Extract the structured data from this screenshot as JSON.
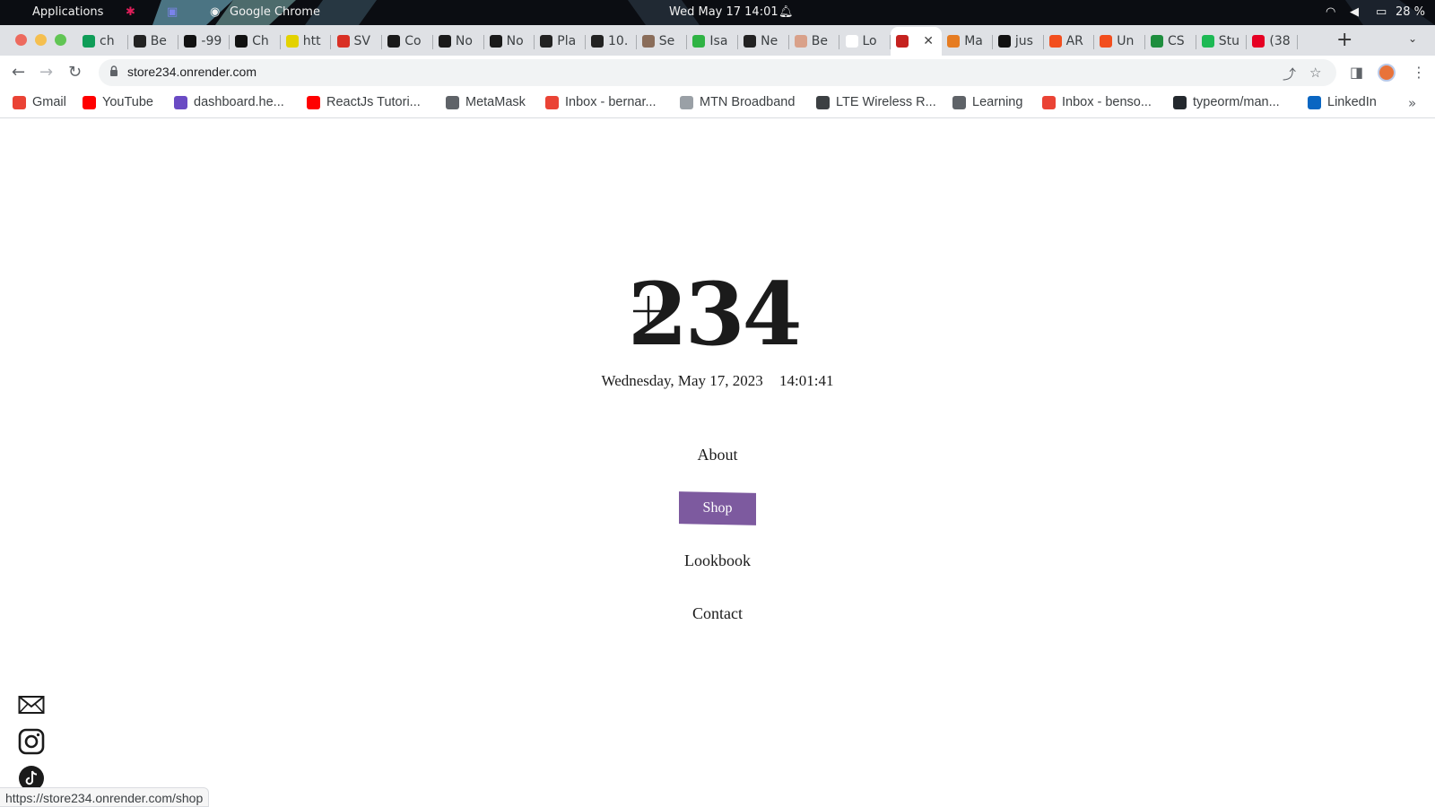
{
  "os_bar": {
    "applications": "Applications",
    "active_app": "Google Chrome",
    "clock": "Wed May 17  14:01",
    "battery": "28 %"
  },
  "tabs": [
    {
      "label": "ch",
      "color": "#0f9d58"
    },
    {
      "label": "Be",
      "color": "#222222",
      "glyph": "W."
    },
    {
      "label": "-99",
      "color": "#111111"
    },
    {
      "label": "Ch",
      "color": "#111111"
    },
    {
      "label": "htt",
      "color": "#e3d200"
    },
    {
      "label": "SV",
      "color": "#d93025"
    },
    {
      "label": "Co",
      "color": "#1a1a1a"
    },
    {
      "label": "No",
      "color": "#1a1a1a"
    },
    {
      "label": "No",
      "color": "#1a1a1a"
    },
    {
      "label": "Pla",
      "color": "#222222"
    },
    {
      "label": "10.",
      "color": "#222222"
    },
    {
      "label": "Se",
      "color": "#8a6d5a"
    },
    {
      "label": "Isa",
      "color": "#2fb344"
    },
    {
      "label": "Ne",
      "color": "#222222"
    },
    {
      "label": "Be",
      "color": "#d9a18a"
    },
    {
      "label": "Lo",
      "color": "#ffffff"
    },
    {
      "label": "",
      "color": "#c5221f",
      "active": true
    },
    {
      "label": "Ma",
      "color": "#e67c22"
    },
    {
      "label": "jus",
      "color": "#111111"
    },
    {
      "label": "AR",
      "color": "#f24e1e"
    },
    {
      "label": "Un",
      "color": "#f24e1e"
    },
    {
      "label": "CS",
      "color": "#1e8e3e"
    },
    {
      "label": "Stu",
      "color": "#1db954"
    },
    {
      "label": "(38",
      "color": "#e60023"
    }
  ],
  "toolbar": {
    "url": "store234.onrender.com"
  },
  "bookmarks": [
    {
      "label": "Gmail",
      "color": "#ea4335"
    },
    {
      "label": "YouTube",
      "color": "#ff0000"
    },
    {
      "label": "dashboard.he...",
      "color": "#6a4bc4"
    },
    {
      "label": "ReactJs Tutori...",
      "color": "#ff0000"
    },
    {
      "label": "MetaMask",
      "color": "#5f6368"
    },
    {
      "label": "Inbox - bernar...",
      "color": "#ea4335"
    },
    {
      "label": "MTN Broadband",
      "color": "#9aa0a6"
    },
    {
      "label": "LTE Wireless R...",
      "color": "#3c4043"
    },
    {
      "label": "Learning",
      "color": "#5f6368"
    },
    {
      "label": "Inbox - benso...",
      "color": "#ea4335"
    },
    {
      "label": "typeorm/man...",
      "color": "#24292e"
    },
    {
      "label": "LinkedIn",
      "color": "#0a66c2"
    }
  ],
  "page": {
    "logo": "234",
    "date": "Wednesday, May 17, 2023",
    "time": "14:01:41",
    "menu": {
      "about": "About",
      "shop": "Shop",
      "lookbook": "Lookbook",
      "contact": "Contact"
    },
    "accent_color": "#7d5a9f"
  },
  "status_bar": {
    "link_url": "https://store234.onrender.com/shop"
  }
}
